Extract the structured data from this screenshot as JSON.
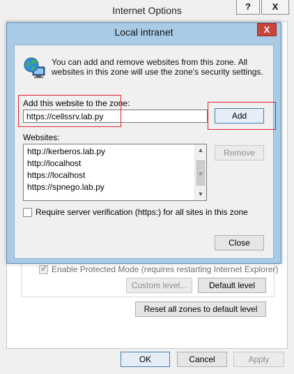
{
  "parent_window": {
    "title": "Internet Options",
    "help_glyph": "?",
    "close_glyph": "X",
    "protected_mode_label": "Enable Protected Mode (requires restarting Internet Explorer)",
    "protected_mode_checked": true,
    "custom_level_label": "Custom level...",
    "default_level_label": "Default level",
    "reset_zones_label": "Reset all zones to default level",
    "ok_label": "OK",
    "cancel_label": "Cancel",
    "apply_label": "Apply"
  },
  "dialog": {
    "title": "Local intranet",
    "close_glyph": "X",
    "intro_text": "You can add and remove websites from this zone. All websites in this zone will use the zone's security settings.",
    "add_label": "Add this website to the zone:",
    "url_value": "https://cellssrv.lab.py",
    "add_button": "Add",
    "websites_label": "Websites:",
    "websites": [
      "http://kerberos.lab.py",
      "http://localhost",
      "https://localhost",
      "https://spnego.lab.py"
    ],
    "remove_button": "Remove",
    "require_verification_label": "Require server verification (https:) for all sites in this zone",
    "require_verification_checked": false,
    "close_button": "Close"
  },
  "icons": {
    "globe": "globe-computer-icon",
    "scroll_up": "scroll-up-arrow-icon",
    "scroll_down": "scroll-down-arrow-icon"
  },
  "colors": {
    "highlight": "#e0222f",
    "dialog_frame": "#a9cbe6",
    "close_button": "#c8453a"
  }
}
